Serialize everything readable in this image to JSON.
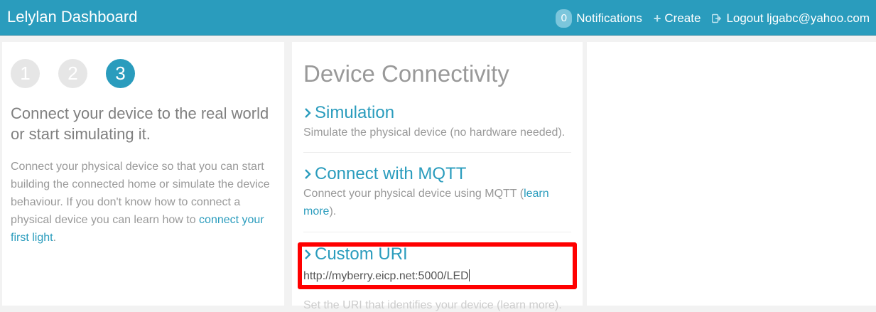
{
  "navbar": {
    "brand": "Lelylan Dashboard",
    "notifications_count": "0",
    "notifications_label": "Notifications",
    "create_label": "Create",
    "logout_label": "Logout ljgabc@yahoo.com"
  },
  "steps": [
    "1",
    "2",
    "3"
  ],
  "active_step": "3",
  "left": {
    "lead": "Connect your device to the real world or start simulating it.",
    "desc_before": "Connect your physical device so that you can start building the connected home or simulate the device behaviour. If you don't know how to connect a physical device you can learn how to ",
    "desc_link": "connect your first light",
    "desc_after": "."
  },
  "main": {
    "title": "Device Connectivity",
    "simulation": {
      "label": "Simulation",
      "text": "Simulate the physical device (no hardware needed)."
    },
    "mqtt": {
      "label": "Connect with MQTT",
      "text_before": "Connect your physical device using MQTT (",
      "text_link": "learn more",
      "text_after": ")."
    },
    "custom_uri": {
      "label": "Custom URI",
      "value": "http://myberry.eicp.net:5000/LED",
      "hint_partial": "Set the URI that identifies your device (learn more)."
    }
  },
  "colors": {
    "accent": "#2a9cbd",
    "highlight": "#ff0000"
  }
}
